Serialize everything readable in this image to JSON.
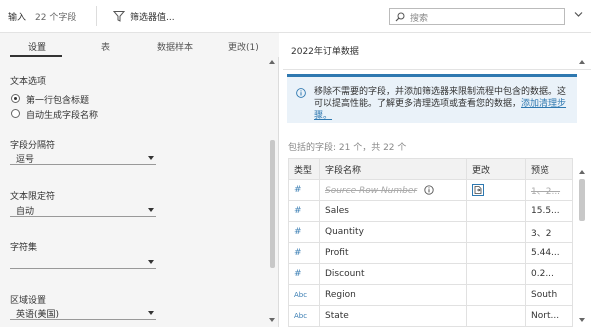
{
  "toolbar": {
    "input_label": "输入",
    "field_count": "22 个字段",
    "filter_label": "筛选器值...",
    "search_placeholder": "搜索"
  },
  "tabs": [
    {
      "label": "设置",
      "active": true
    },
    {
      "label": "表"
    },
    {
      "label": "数据样本"
    },
    {
      "label": "更改(1)"
    }
  ],
  "settings": {
    "text_options_title": "文本选项",
    "radio_first_row": "第一行包含标题",
    "radio_auto_names": "自动生成字段名称",
    "field_sep_label": "字段分隔符",
    "field_sep_value": "逗号",
    "text_qualifier_label": "文本限定符",
    "text_qualifier_value": "自动",
    "charset_label": "字符集",
    "charset_value": "",
    "locale_label": "区域设置",
    "locale_value": "英语(美国)"
  },
  "right": {
    "title": "2022年订单数据",
    "info_text": "移除不需要的字段，并添加筛选器来限制流程中包含的数据。这可以提高性能。了解更多清理选项或查看您的数据，",
    "info_link": "添加清理步骤。",
    "fields_count": "包括的字段: 21 个，共 22 个",
    "columns": {
      "type": "类型",
      "name": "字段名称",
      "change": "更改",
      "preview": "预览"
    },
    "rows": [
      {
        "type": "#",
        "name": "Source Row Number",
        "excluded": true,
        "preview": "1、2..."
      },
      {
        "type": "#",
        "name": "Sales",
        "preview": "15.5..."
      },
      {
        "type": "#",
        "name": "Quantity",
        "preview": "3、2"
      },
      {
        "type": "#",
        "name": "Profit",
        "preview": "5.44..."
      },
      {
        "type": "#",
        "name": "Discount",
        "preview": "0.2..."
      },
      {
        "type": "Abc",
        "name": "Region",
        "preview": "South"
      },
      {
        "type": "Abc",
        "name": "State",
        "preview": "Nort..."
      }
    ]
  },
  "colors": {
    "accent": "#2e78b0",
    "info_bg": "#eaf2f9"
  }
}
